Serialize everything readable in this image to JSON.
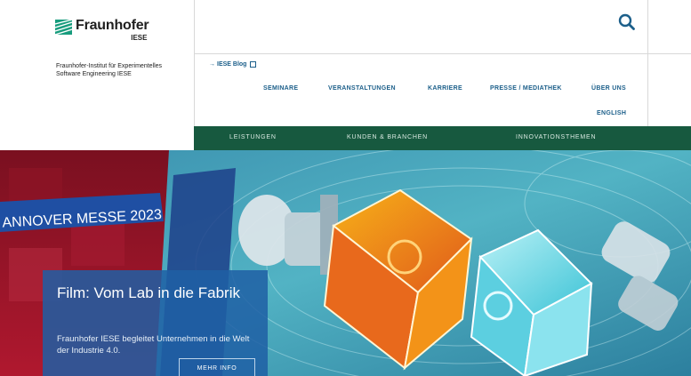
{
  "brand": {
    "name": "Fraunhofer",
    "sub": "IESE",
    "green": "#17593f"
  },
  "institute": {
    "line1": "Fraunhofer-Institut für Experimentelles",
    "line2": "Software Engineering IESE"
  },
  "search": {
    "icon": "search-icon"
  },
  "blog": {
    "label": "IESE Blog",
    "icon": "arrow-right-icon"
  },
  "top_nav": [
    {
      "label": "SEMINARE"
    },
    {
      "label": "VERANSTALTUNGEN"
    },
    {
      "label": "KARRIERE"
    },
    {
      "label": "PRESSE / MEDIATHEK"
    },
    {
      "label": "ÜBER UNS"
    }
  ],
  "language": {
    "label": "ENGLISH"
  },
  "main_nav": [
    {
      "label": "LEISTUNGEN"
    },
    {
      "label": "KUNDEN & BRANCHEN"
    },
    {
      "label": "INNOVATIONSTHEMEN"
    }
  ],
  "hero": {
    "banner": "ANNOVER MESSE 2023",
    "title": "Film: Vom Lab in die Fabrik",
    "text": "Fraunhofer IESE begleitet Unternehmen in die Welt der Industrie 4.0.",
    "button": "MEHR INFO"
  },
  "colors": {
    "link": "#1c5f8a",
    "teaser": "#1e5fa5"
  }
}
